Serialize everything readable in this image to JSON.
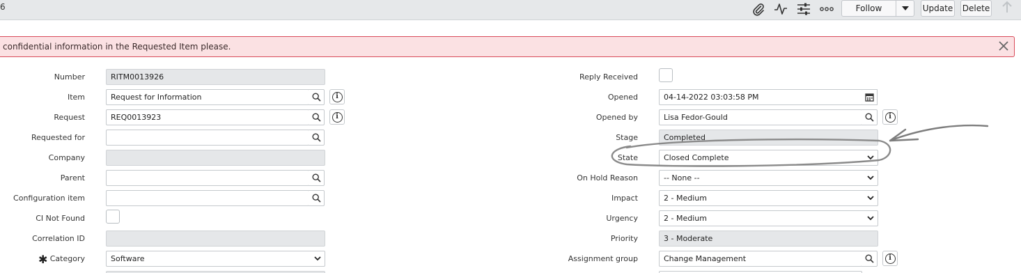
{
  "header": {
    "title": "6",
    "follow_label": "Follow",
    "update_label": "Update",
    "delete_label": "Delete"
  },
  "alert": {
    "message": "confidential information in the Requested Item please."
  },
  "left": {
    "number": {
      "label": "Number",
      "value": "RITM0013926"
    },
    "item": {
      "label": "Item",
      "value": "Request for Information"
    },
    "request": {
      "label": "Request",
      "value": "REQ0013923"
    },
    "requested_for": {
      "label": "Requested for",
      "value": ""
    },
    "company": {
      "label": "Company",
      "value": ""
    },
    "parent": {
      "label": "Parent",
      "value": ""
    },
    "configuration_item": {
      "label": "Configuration item",
      "value": ""
    },
    "ci_not_found": {
      "label": "CI Not Found"
    },
    "correlation_id": {
      "label": "Correlation ID",
      "value": ""
    },
    "category": {
      "label": "Category",
      "value": "Software"
    }
  },
  "right": {
    "reply_received": {
      "label": "Reply Received"
    },
    "opened": {
      "label": "Opened",
      "value": "04-14-2022 03:03:58 PM"
    },
    "opened_by": {
      "label": "Opened by",
      "value": "Lisa Fedor-Gould"
    },
    "stage": {
      "label": "Stage",
      "value": "Completed"
    },
    "state": {
      "label": "State",
      "value": "Closed Complete"
    },
    "on_hold_reason": {
      "label": "On Hold Reason",
      "value": "-- None --"
    },
    "impact": {
      "label": "Impact",
      "value": "2 - Medium"
    },
    "urgency": {
      "label": "Urgency",
      "value": "2 - Medium"
    },
    "priority": {
      "label": "Priority",
      "value": "3 - Moderate"
    },
    "assignment_group": {
      "label": "Assignment group",
      "value": "Change Management"
    }
  },
  "icons": {
    "attachment": "paperclip-icon",
    "activity": "activity-stream-icon",
    "personalize": "sliders-icon",
    "more": "more-options-icon",
    "lookup": "search-icon",
    "info": "info-icon",
    "calendar": "calendar-icon",
    "close": "close-icon",
    "chevron": "chevron-down-icon"
  },
  "colors": {
    "alert_bg": "#fbe1e3",
    "alert_border": "#d94a59",
    "header_bg": "#e6e8ea",
    "readonly_bg": "#e5e7e9"
  }
}
